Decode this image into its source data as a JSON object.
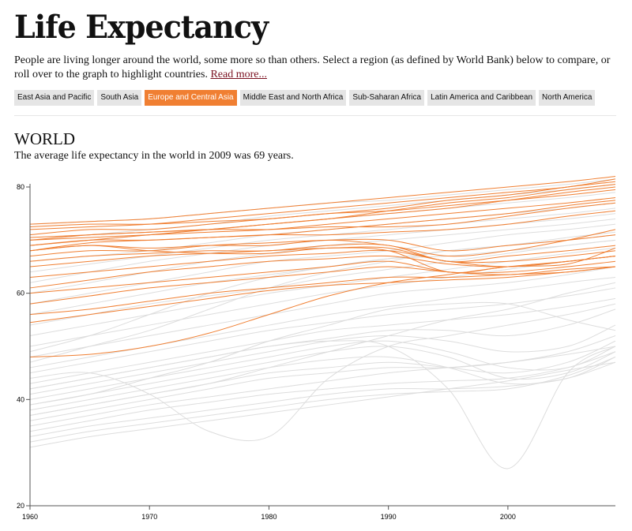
{
  "header": {
    "title": "Life Expectancy",
    "intro": "People are living longer around the world, some more so than others. Select a region (as defined by World Bank) below to compare, or roll over to the graph to highlight countries.",
    "read_more": "Read more..."
  },
  "regions": [
    {
      "label": "East Asia and Pacific",
      "active": false
    },
    {
      "label": "South Asia",
      "active": false
    },
    {
      "label": "Europe and Central Asia",
      "active": true
    },
    {
      "label": "Middle East and North Africa",
      "active": false
    },
    {
      "label": "Sub-Saharan Africa",
      "active": false
    },
    {
      "label": "Latin America and Caribbean",
      "active": false
    },
    {
      "label": "North America",
      "active": false
    }
  ],
  "section": {
    "title": "WORLD",
    "summary": "The average life expectancy in the world in 2009 was 69 years."
  },
  "chart_data": {
    "type": "line",
    "xlim": [
      1960,
      2009
    ],
    "ylim": [
      20,
      80
    ],
    "x_ticks": [
      "1960",
      "1970",
      "1980",
      "1990",
      "2000"
    ],
    "y_ticks": [
      "20",
      "40",
      "60",
      "80"
    ],
    "colors": {
      "highlight": "#f07f32",
      "other": "#dddddd"
    },
    "x": [
      1960,
      1965,
      1970,
      1975,
      1980,
      1985,
      1990,
      1995,
      2000,
      2005,
      2009
    ],
    "highlighted": [
      [
        73,
        73.5,
        74,
        75,
        76,
        77,
        78,
        79,
        80,
        81,
        82
      ],
      [
        72,
        72.5,
        73,
        74,
        75,
        76,
        77,
        78,
        79,
        80,
        81.5
      ],
      [
        71,
        72,
        72,
        73,
        74,
        75,
        76,
        77.5,
        78.5,
        80,
        81
      ],
      [
        70,
        71,
        71.5,
        72,
        73,
        74,
        75.5,
        77,
        78,
        79.5,
        80.5
      ],
      [
        69,
        70,
        71,
        72,
        73,
        74,
        75,
        76,
        77.5,
        79,
        80
      ],
      [
        70,
        70.5,
        71,
        71.5,
        72,
        73,
        74,
        75,
        76,
        77,
        78
      ],
      [
        68,
        69.5,
        70,
        70.5,
        71,
        72,
        73,
        74,
        75,
        76.5,
        77.5
      ],
      [
        69,
        70,
        70,
        70.5,
        71,
        71,
        71.5,
        72,
        73,
        74.5,
        75.5
      ],
      [
        68,
        69,
        68.5,
        69,
        69,
        70,
        69,
        67,
        68,
        70,
        72
      ],
      [
        67,
        68,
        68,
        69,
        69.5,
        70,
        70,
        68,
        69,
        70,
        71
      ],
      [
        68,
        69,
        68,
        67.5,
        67.5,
        68.5,
        68,
        64,
        65,
        65.5,
        68.5
      ],
      [
        66,
        67,
        67.5,
        68,
        68,
        69,
        69,
        66,
        67,
        68,
        69
      ],
      [
        65,
        66,
        67,
        67.5,
        68,
        68.5,
        68.5,
        66,
        66,
        67,
        68
      ],
      [
        63,
        64,
        65,
        66,
        67,
        67.5,
        68,
        66,
        65,
        66,
        67
      ],
      [
        61,
        62.5,
        64,
        65,
        66,
        66.5,
        67,
        65.5,
        65,
        66,
        67
      ],
      [
        60,
        61,
        62,
        63,
        64,
        65,
        66,
        64,
        64,
        65,
        66
      ],
      [
        58,
        59.5,
        61,
        62,
        63,
        64,
        65,
        64,
        63.5,
        64.5,
        65
      ],
      [
        56,
        57,
        58.5,
        60,
        61,
        62,
        63,
        63,
        63.5,
        64,
        65
      ],
      [
        54.5,
        56,
        57.5,
        59,
        60.5,
        61.5,
        62,
        62.5,
        63,
        64,
        65
      ],
      [
        48,
        48.5,
        50,
        52.5,
        56,
        59.5,
        62,
        63.5,
        65,
        66,
        67
      ],
      [
        72.5,
        73,
        73,
        73.5,
        74,
        75,
        75.5,
        76.5,
        77.5,
        78.5,
        79.5
      ],
      [
        70.5,
        71,
        71.5,
        72,
        72,
        72.5,
        72.5,
        73,
        74.5,
        76,
        77
      ]
    ],
    "others": [
      [
        73,
        73.5,
        74,
        75,
        76,
        77,
        77.5,
        78.5,
        79.5,
        80.5,
        81.5
      ],
      [
        70,
        71,
        72,
        73,
        74.5,
        75.5,
        76.5,
        77.5,
        78.5,
        79.5,
        80.5
      ],
      [
        69,
        70,
        71,
        72,
        73,
        74,
        75,
        76,
        77,
        78,
        79
      ],
      [
        66,
        67,
        68,
        69.5,
        71,
        72,
        73,
        74,
        75,
        76,
        77
      ],
      [
        64,
        65.5,
        67,
        68.5,
        70,
        71,
        72,
        73,
        74,
        75,
        76
      ],
      [
        62,
        64,
        66,
        67.5,
        69,
        70,
        71,
        72,
        73,
        74,
        75
      ],
      [
        60,
        62,
        64,
        66,
        67.5,
        69,
        70,
        71,
        72,
        73,
        74
      ],
      [
        58,
        60,
        62,
        64,
        66,
        67,
        68,
        69.5,
        71,
        72,
        73
      ],
      [
        56,
        58,
        60,
        62,
        63.5,
        65,
        66.5,
        68,
        69,
        70.5,
        71.5
      ],
      [
        54,
        56,
        58,
        59.5,
        61,
        63,
        64.5,
        66,
        67.5,
        69,
        70
      ],
      [
        52,
        54,
        56,
        58,
        60,
        61.5,
        63,
        64.5,
        66,
        67.5,
        68.5
      ],
      [
        50,
        52,
        54,
        56,
        58,
        60,
        61.5,
        63,
        64.5,
        66,
        67
      ],
      [
        48,
        50,
        52,
        54,
        56,
        58,
        60,
        61,
        62,
        63.5,
        65
      ],
      [
        46,
        48,
        50,
        52,
        54,
        56,
        57.5,
        59,
        60.5,
        62,
        63
      ],
      [
        45,
        47,
        49,
        51,
        53,
        54.5,
        56,
        57,
        58,
        59.5,
        61
      ],
      [
        43,
        45,
        47,
        49,
        51,
        53,
        54,
        55,
        56,
        57.5,
        59
      ],
      [
        42,
        44,
        46,
        48,
        50,
        51.5,
        53,
        53,
        52,
        54,
        57
      ],
      [
        41,
        43,
        45,
        47,
        49,
        51,
        52,
        51,
        49,
        50,
        54
      ],
      [
        40,
        42,
        44,
        46,
        48,
        50,
        51,
        49,
        46,
        46,
        50
      ],
      [
        39,
        41,
        43,
        45,
        47,
        49,
        50,
        48,
        44,
        45,
        49
      ],
      [
        38,
        40,
        42,
        44,
        46,
        47.5,
        48,
        46,
        43,
        44,
        48
      ],
      [
        37,
        39,
        41,
        43,
        45,
        46,
        47,
        46,
        45,
        47,
        51
      ],
      [
        36,
        38,
        40,
        42,
        44,
        45,
        46,
        46,
        47,
        49,
        52
      ],
      [
        35,
        37,
        39,
        40.5,
        42,
        43.5,
        45,
        46,
        47,
        48.5,
        50
      ],
      [
        34,
        36,
        38,
        39.5,
        41,
        42,
        43,
        43.5,
        44,
        46,
        49
      ],
      [
        33,
        35,
        36.5,
        38,
        39.5,
        41,
        42,
        42,
        42.5,
        44,
        47
      ],
      [
        32,
        34,
        35.5,
        37,
        38.5,
        40,
        41,
        41.5,
        42,
        44.5,
        48
      ],
      [
        31,
        33,
        34.5,
        36,
        37.5,
        39,
        40.5,
        42,
        43.5,
        45.5,
        47
      ],
      [
        42,
        44,
        46,
        48,
        50,
        51,
        50,
        42,
        27,
        45,
        50
      ],
      [
        44,
        45,
        41,
        34,
        33,
        44,
        50,
        52,
        54,
        56,
        58
      ],
      [
        39,
        41,
        44,
        47,
        51,
        54,
        57,
        58,
        58,
        55,
        53
      ],
      [
        37,
        39,
        41,
        43,
        46,
        49,
        52,
        55,
        57,
        60,
        62
      ],
      [
        47,
        50,
        53,
        57,
        61,
        64,
        66,
        68,
        69,
        70,
        71
      ],
      [
        49,
        52,
        56,
        60,
        63,
        65,
        66.5,
        67,
        68,
        69,
        70
      ]
    ]
  }
}
